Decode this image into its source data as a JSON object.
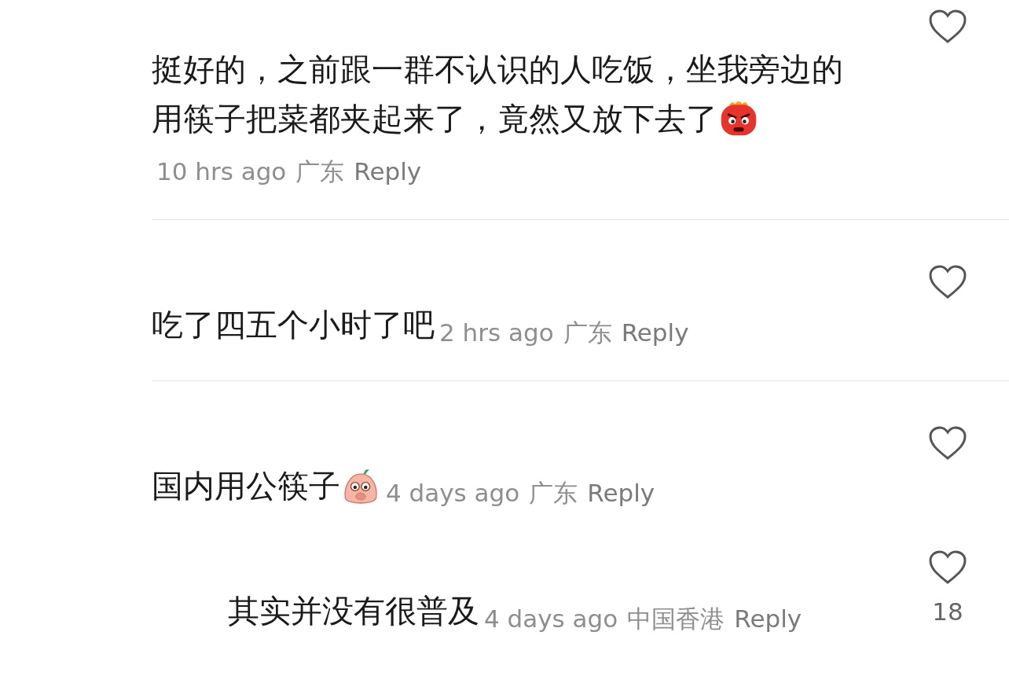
{
  "comments": [
    {
      "text": "挺好的，之前跟一群不认识的人吃饭，坐我旁边的用筷子把菜都夹起来了，竟然又放下去了",
      "emoji": true,
      "time": "10 hrs ago",
      "location": "广东",
      "reply_label": "Reply",
      "liked": false
    },
    {
      "text": "吃了四五个小时了吧",
      "emoji": false,
      "time": "2 hrs ago",
      "location": "广东",
      "reply_label": "Reply",
      "liked": false
    },
    {
      "text": "国内用公筷子",
      "emoji": true,
      "time": "4 days ago",
      "location": "广东",
      "reply_label": "Reply",
      "liked": false,
      "children": [
        {
          "text": "其实并没有很普及",
          "emoji": false,
          "time": "4 days ago",
          "location": "中国香港",
          "reply_label": "Reply",
          "liked": false,
          "like_count": "18"
        }
      ]
    }
  ]
}
